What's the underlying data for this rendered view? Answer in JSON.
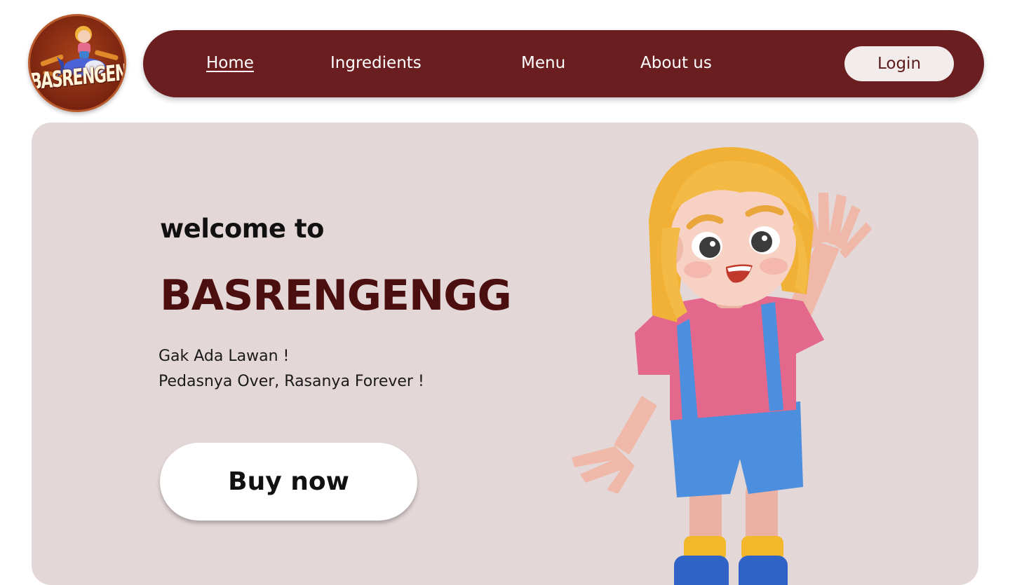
{
  "logo": {
    "text": "BASRENGENGG"
  },
  "nav": {
    "links": [
      "Home",
      "Ingredients",
      "Menu",
      "About us"
    ],
    "active": "Home",
    "login_label": "Login"
  },
  "hero": {
    "welcome": "welcome to",
    "brand": "BASRENGENGG",
    "tagline_line1": "Gak Ada Lawan !",
    "tagline_line2": "Pedasnya Over, Rasanya Forever !",
    "cta_label": "Buy now"
  },
  "colors": {
    "navbar_bg": "#6a1e1f",
    "hero_bg": "#e4d7d8",
    "brand_text": "#4c0f10",
    "login_bg": "#f3ecec"
  }
}
